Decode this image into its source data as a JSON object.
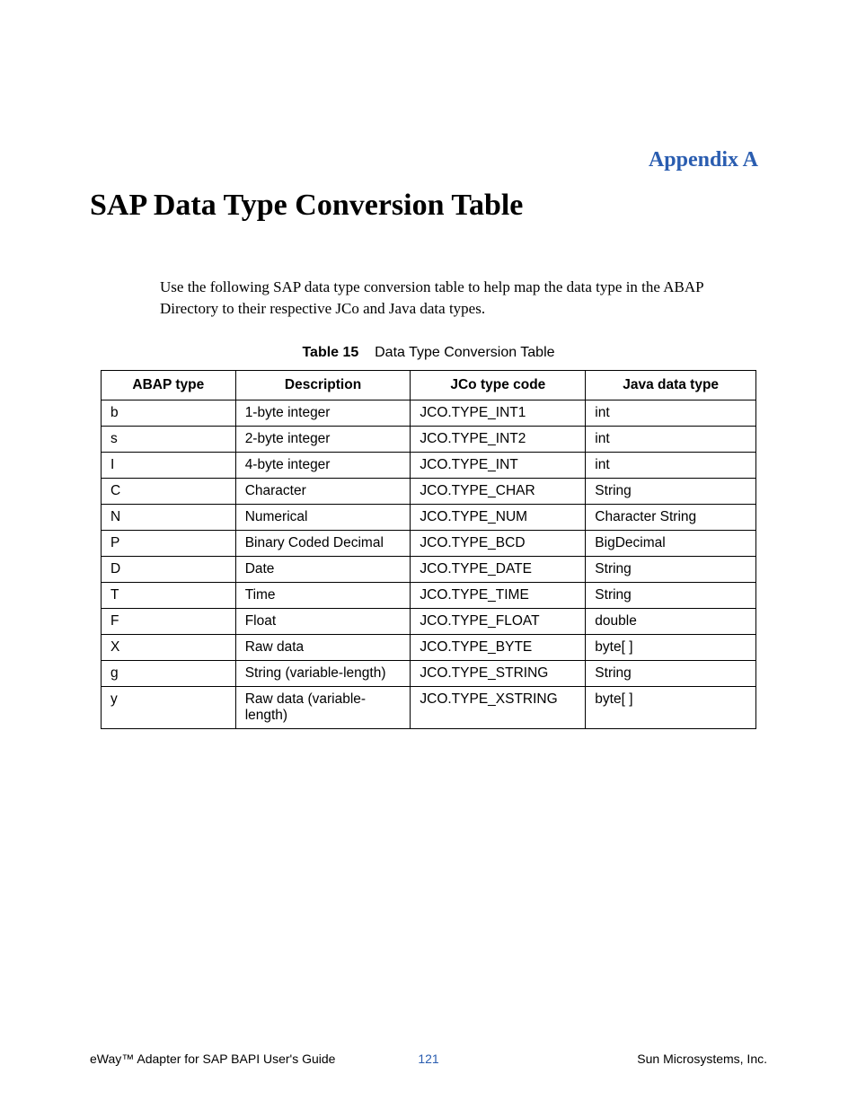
{
  "appendix_label": "Appendix A",
  "chapter_title": "SAP Data Type Conversion Table",
  "intro_text": "Use the following SAP data type conversion table to help map the data type in the ABAP Directory to their respective JCo and Java data types.",
  "table_caption_label": "Table 15",
  "table_caption_text": "Data Type Conversion Table",
  "headers": {
    "abap": "ABAP type",
    "desc": "Description",
    "jco": "JCo type code",
    "java": "Java data type"
  },
  "rows": [
    {
      "abap": "b",
      "desc": "1-byte integer",
      "jco": "JCO.TYPE_INT1",
      "java": "int"
    },
    {
      "abap": "s",
      "desc": "2-byte integer",
      "jco": "JCO.TYPE_INT2",
      "java": "int"
    },
    {
      "abap": "I",
      "desc": "4-byte integer",
      "jco": "JCO.TYPE_INT",
      "java": "int"
    },
    {
      "abap": "C",
      "desc": "Character",
      "jco": "JCO.TYPE_CHAR",
      "java": "String"
    },
    {
      "abap": "N",
      "desc": "Numerical",
      "jco": "JCO.TYPE_NUM",
      "java": "Character String"
    },
    {
      "abap": "P",
      "desc": "Binary Coded Decimal",
      "jco": "JCO.TYPE_BCD",
      "java": "BigDecimal"
    },
    {
      "abap": "D",
      "desc": "Date",
      "jco": "JCO.TYPE_DATE",
      "java": "String"
    },
    {
      "abap": "T",
      "desc": "Time",
      "jco": "JCO.TYPE_TIME",
      "java": "String"
    },
    {
      "abap": "F",
      "desc": "Float",
      "jco": "JCO.TYPE_FLOAT",
      "java": "double"
    },
    {
      "abap": "X",
      "desc": "Raw data",
      "jco": "JCO.TYPE_BYTE",
      "java": "byte[ ]"
    },
    {
      "abap": "g",
      "desc": "String (variable-length)",
      "jco": "JCO.TYPE_STRING",
      "java": "String"
    },
    {
      "abap": "y",
      "desc": "Raw data (variable-length)",
      "jco": "JCO.TYPE_XSTRING",
      "java": "byte[ ]"
    }
  ],
  "footer": {
    "left": "eWay™ Adapter for SAP BAPI User's Guide",
    "center": "121",
    "right": "Sun Microsystems, Inc."
  }
}
